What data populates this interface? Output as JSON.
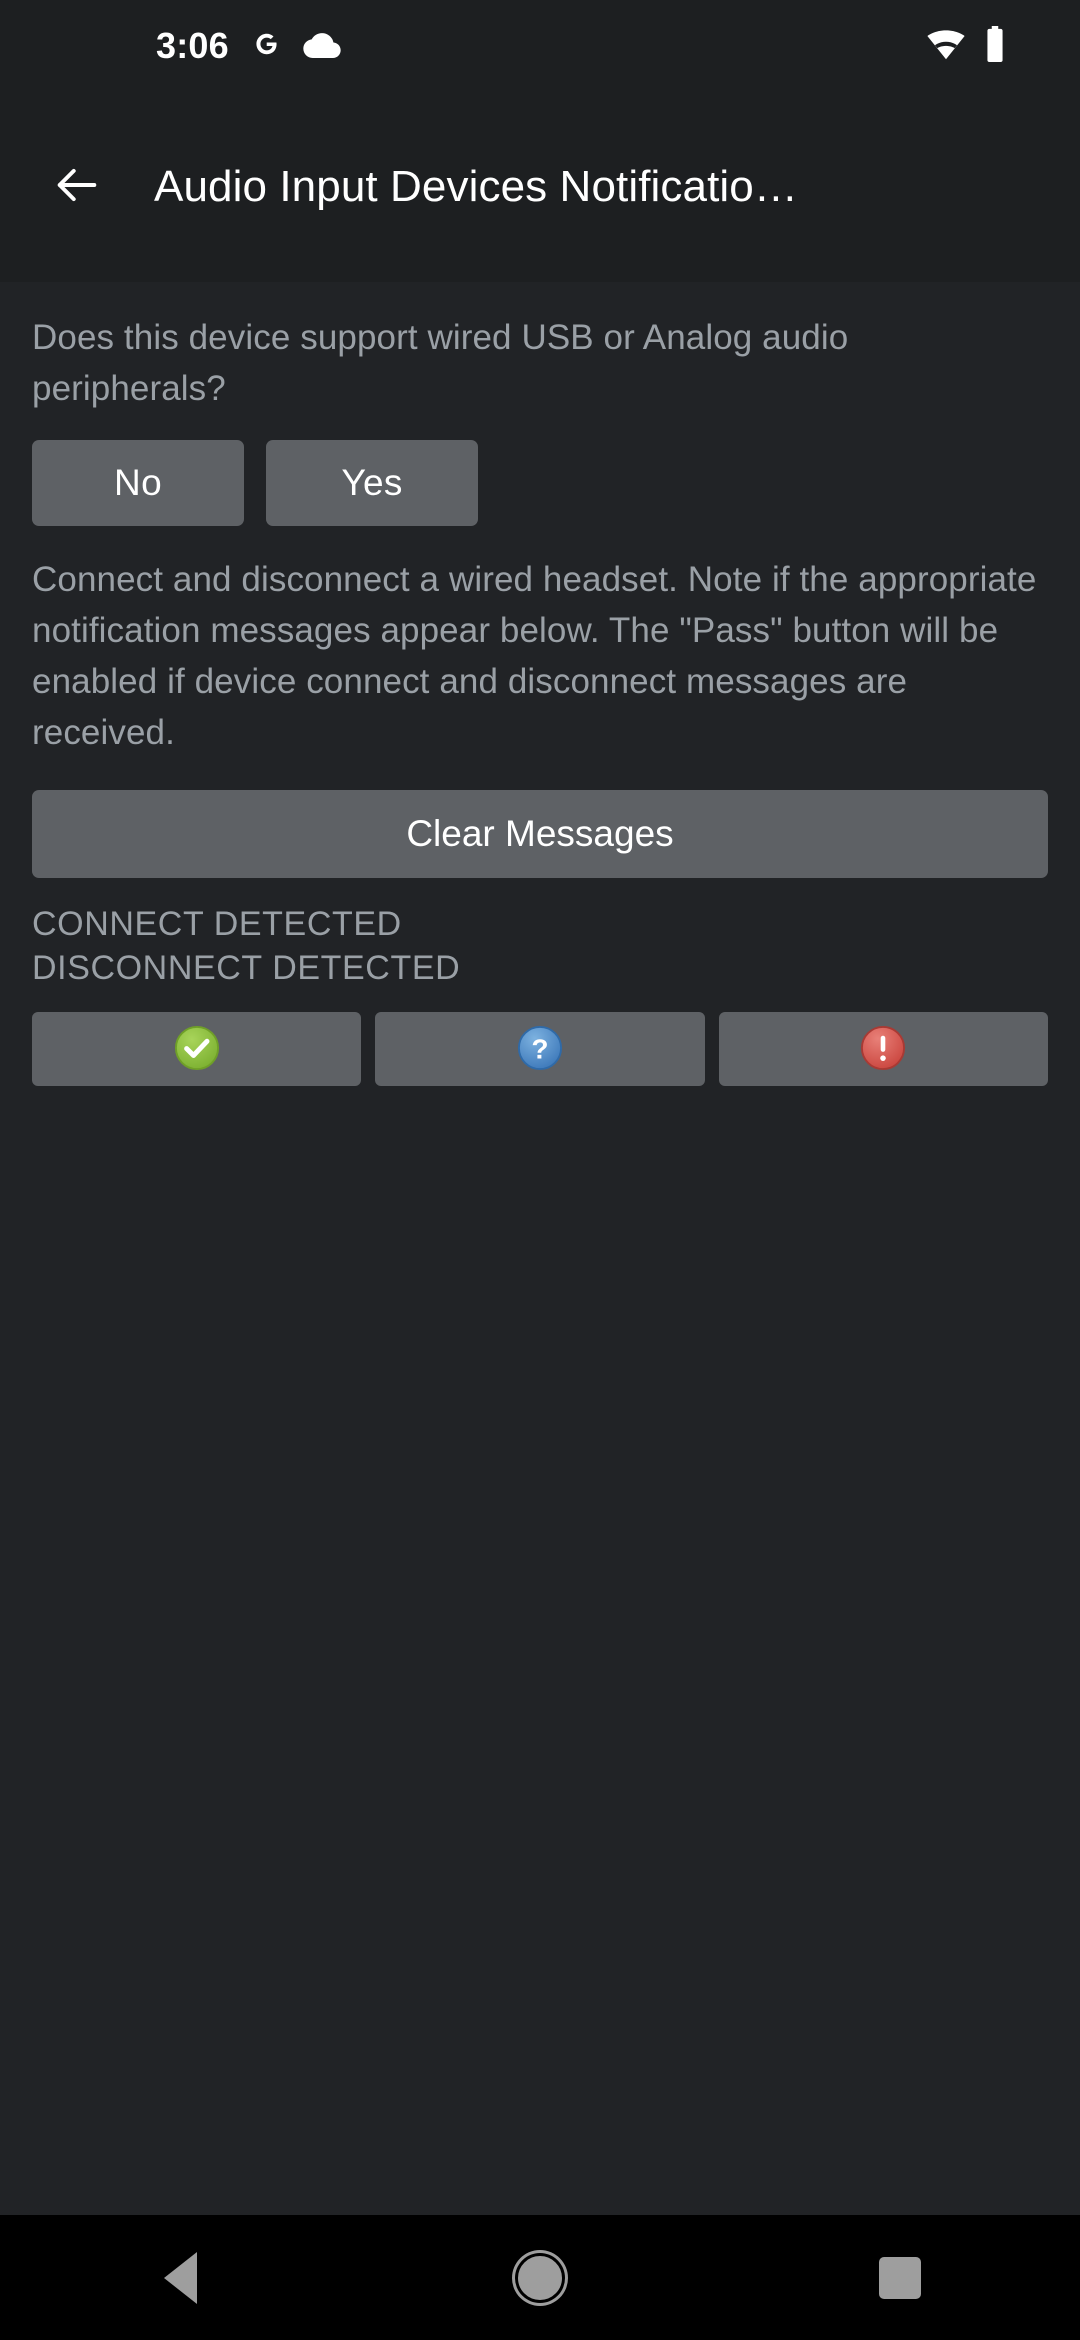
{
  "status_bar": {
    "time": "3:06",
    "icons_left": [
      "google-g-icon",
      "cloud-icon"
    ],
    "icons_right": [
      "wifi-icon",
      "battery-icon"
    ]
  },
  "app_bar": {
    "back_icon": "back-arrow-icon",
    "title": "Audio Input Devices Notificatio…"
  },
  "main": {
    "question_text": "Does this device support wired USB or Analog audio peripherals?",
    "answer_buttons": [
      {
        "label": "No",
        "name": "no-button"
      },
      {
        "label": "Yes",
        "name": "yes-button"
      }
    ],
    "instruction_text": "Connect and disconnect a wired headset. Note if the appropriate notification messages appear below. The \"Pass\" button will be enabled if device connect and disconnect messages are received.",
    "clear_messages_label": "Clear Messages",
    "status_messages": [
      "CONNECT DETECTED",
      "DISCONNECT DETECTED"
    ],
    "result_buttons": [
      {
        "icon": "check-circle-icon",
        "name": "pass-button",
        "color": "#8cc63f"
      },
      {
        "icon": "question-circle-icon",
        "name": "info-button",
        "color": "#4d8fd1"
      },
      {
        "icon": "exclamation-circle-icon",
        "name": "fail-button",
        "color": "#d9534f"
      }
    ]
  },
  "nav_bar": {
    "items": [
      {
        "name": "nav-back-button",
        "icon": "triangle-back-icon"
      },
      {
        "name": "nav-home-button",
        "icon": "circle-home-icon"
      },
      {
        "name": "nav-recents-button",
        "icon": "square-recents-icon"
      }
    ]
  },
  "colors": {
    "app_bar_bg": "#1d1f21",
    "content_bg": "#212326",
    "button_bg": "#5e6165",
    "secondary_text": "#9aa0a6",
    "primary_text": "#ffffff",
    "nav_bg": "#000000"
  }
}
